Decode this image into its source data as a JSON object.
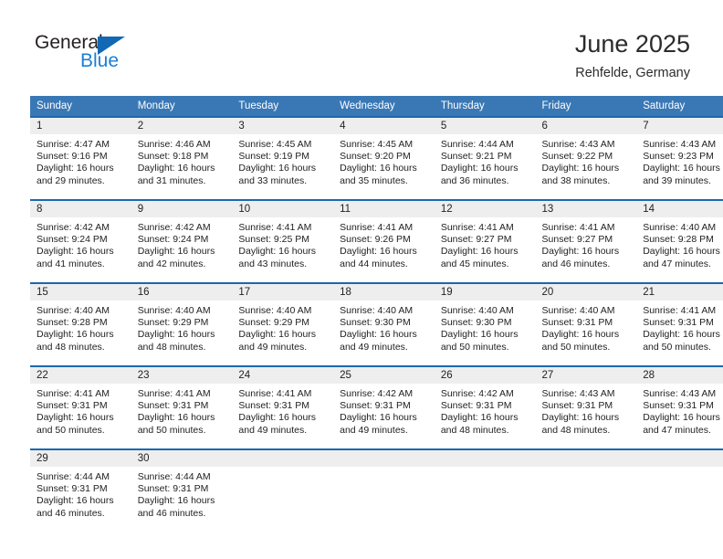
{
  "logo": {
    "general_text": "General",
    "blue_text": "Blue",
    "triangle_color": "#1268b3",
    "blue_color": "#1b7fd4"
  },
  "header": {
    "title": "June 2025",
    "subtitle": "Rehfelde, Germany"
  },
  "theme": {
    "header_bg": "#3a78b5",
    "row_divider": "#1a68b0",
    "daynum_bg": "#eeeeee"
  },
  "calendar": {
    "weekday_headers": [
      "Sunday",
      "Monday",
      "Tuesday",
      "Wednesday",
      "Thursday",
      "Friday",
      "Saturday"
    ],
    "weeks": [
      [
        {
          "day": "1",
          "sunrise": "Sunrise: 4:47 AM",
          "sunset": "Sunset: 9:16 PM",
          "daylight_1": "Daylight: 16 hours",
          "daylight_2": "and 29 minutes."
        },
        {
          "day": "2",
          "sunrise": "Sunrise: 4:46 AM",
          "sunset": "Sunset: 9:18 PM",
          "daylight_1": "Daylight: 16 hours",
          "daylight_2": "and 31 minutes."
        },
        {
          "day": "3",
          "sunrise": "Sunrise: 4:45 AM",
          "sunset": "Sunset: 9:19 PM",
          "daylight_1": "Daylight: 16 hours",
          "daylight_2": "and 33 minutes."
        },
        {
          "day": "4",
          "sunrise": "Sunrise: 4:45 AM",
          "sunset": "Sunset: 9:20 PM",
          "daylight_1": "Daylight: 16 hours",
          "daylight_2": "and 35 minutes."
        },
        {
          "day": "5",
          "sunrise": "Sunrise: 4:44 AM",
          "sunset": "Sunset: 9:21 PM",
          "daylight_1": "Daylight: 16 hours",
          "daylight_2": "and 36 minutes."
        },
        {
          "day": "6",
          "sunrise": "Sunrise: 4:43 AM",
          "sunset": "Sunset: 9:22 PM",
          "daylight_1": "Daylight: 16 hours",
          "daylight_2": "and 38 minutes."
        },
        {
          "day": "7",
          "sunrise": "Sunrise: 4:43 AM",
          "sunset": "Sunset: 9:23 PM",
          "daylight_1": "Daylight: 16 hours",
          "daylight_2": "and 39 minutes."
        }
      ],
      [
        {
          "day": "8",
          "sunrise": "Sunrise: 4:42 AM",
          "sunset": "Sunset: 9:24 PM",
          "daylight_1": "Daylight: 16 hours",
          "daylight_2": "and 41 minutes."
        },
        {
          "day": "9",
          "sunrise": "Sunrise: 4:42 AM",
          "sunset": "Sunset: 9:24 PM",
          "daylight_1": "Daylight: 16 hours",
          "daylight_2": "and 42 minutes."
        },
        {
          "day": "10",
          "sunrise": "Sunrise: 4:41 AM",
          "sunset": "Sunset: 9:25 PM",
          "daylight_1": "Daylight: 16 hours",
          "daylight_2": "and 43 minutes."
        },
        {
          "day": "11",
          "sunrise": "Sunrise: 4:41 AM",
          "sunset": "Sunset: 9:26 PM",
          "daylight_1": "Daylight: 16 hours",
          "daylight_2": "and 44 minutes."
        },
        {
          "day": "12",
          "sunrise": "Sunrise: 4:41 AM",
          "sunset": "Sunset: 9:27 PM",
          "daylight_1": "Daylight: 16 hours",
          "daylight_2": "and 45 minutes."
        },
        {
          "day": "13",
          "sunrise": "Sunrise: 4:41 AM",
          "sunset": "Sunset: 9:27 PM",
          "daylight_1": "Daylight: 16 hours",
          "daylight_2": "and 46 minutes."
        },
        {
          "day": "14",
          "sunrise": "Sunrise: 4:40 AM",
          "sunset": "Sunset: 9:28 PM",
          "daylight_1": "Daylight: 16 hours",
          "daylight_2": "and 47 minutes."
        }
      ],
      [
        {
          "day": "15",
          "sunrise": "Sunrise: 4:40 AM",
          "sunset": "Sunset: 9:28 PM",
          "daylight_1": "Daylight: 16 hours",
          "daylight_2": "and 48 minutes."
        },
        {
          "day": "16",
          "sunrise": "Sunrise: 4:40 AM",
          "sunset": "Sunset: 9:29 PM",
          "daylight_1": "Daylight: 16 hours",
          "daylight_2": "and 48 minutes."
        },
        {
          "day": "17",
          "sunrise": "Sunrise: 4:40 AM",
          "sunset": "Sunset: 9:29 PM",
          "daylight_1": "Daylight: 16 hours",
          "daylight_2": "and 49 minutes."
        },
        {
          "day": "18",
          "sunrise": "Sunrise: 4:40 AM",
          "sunset": "Sunset: 9:30 PM",
          "daylight_1": "Daylight: 16 hours",
          "daylight_2": "and 49 minutes."
        },
        {
          "day": "19",
          "sunrise": "Sunrise: 4:40 AM",
          "sunset": "Sunset: 9:30 PM",
          "daylight_1": "Daylight: 16 hours",
          "daylight_2": "and 50 minutes."
        },
        {
          "day": "20",
          "sunrise": "Sunrise: 4:40 AM",
          "sunset": "Sunset: 9:31 PM",
          "daylight_1": "Daylight: 16 hours",
          "daylight_2": "and 50 minutes."
        },
        {
          "day": "21",
          "sunrise": "Sunrise: 4:41 AM",
          "sunset": "Sunset: 9:31 PM",
          "daylight_1": "Daylight: 16 hours",
          "daylight_2": "and 50 minutes."
        }
      ],
      [
        {
          "day": "22",
          "sunrise": "Sunrise: 4:41 AM",
          "sunset": "Sunset: 9:31 PM",
          "daylight_1": "Daylight: 16 hours",
          "daylight_2": "and 50 minutes."
        },
        {
          "day": "23",
          "sunrise": "Sunrise: 4:41 AM",
          "sunset": "Sunset: 9:31 PM",
          "daylight_1": "Daylight: 16 hours",
          "daylight_2": "and 50 minutes."
        },
        {
          "day": "24",
          "sunrise": "Sunrise: 4:41 AM",
          "sunset": "Sunset: 9:31 PM",
          "daylight_1": "Daylight: 16 hours",
          "daylight_2": "and 49 minutes."
        },
        {
          "day": "25",
          "sunrise": "Sunrise: 4:42 AM",
          "sunset": "Sunset: 9:31 PM",
          "daylight_1": "Daylight: 16 hours",
          "daylight_2": "and 49 minutes."
        },
        {
          "day": "26",
          "sunrise": "Sunrise: 4:42 AM",
          "sunset": "Sunset: 9:31 PM",
          "daylight_1": "Daylight: 16 hours",
          "daylight_2": "and 48 minutes."
        },
        {
          "day": "27",
          "sunrise": "Sunrise: 4:43 AM",
          "sunset": "Sunset: 9:31 PM",
          "daylight_1": "Daylight: 16 hours",
          "daylight_2": "and 48 minutes."
        },
        {
          "day": "28",
          "sunrise": "Sunrise: 4:43 AM",
          "sunset": "Sunset: 9:31 PM",
          "daylight_1": "Daylight: 16 hours",
          "daylight_2": "and 47 minutes."
        }
      ],
      [
        {
          "day": "29",
          "sunrise": "Sunrise: 4:44 AM",
          "sunset": "Sunset: 9:31 PM",
          "daylight_1": "Daylight: 16 hours",
          "daylight_2": "and 46 minutes."
        },
        {
          "day": "30",
          "sunrise": "Sunrise: 4:44 AM",
          "sunset": "Sunset: 9:31 PM",
          "daylight_1": "Daylight: 16 hours",
          "daylight_2": "and 46 minutes."
        },
        {
          "day": "",
          "sunrise": "",
          "sunset": "",
          "daylight_1": "",
          "daylight_2": ""
        },
        {
          "day": "",
          "sunrise": "",
          "sunset": "",
          "daylight_1": "",
          "daylight_2": ""
        },
        {
          "day": "",
          "sunrise": "",
          "sunset": "",
          "daylight_1": "",
          "daylight_2": ""
        },
        {
          "day": "",
          "sunrise": "",
          "sunset": "",
          "daylight_1": "",
          "daylight_2": ""
        },
        {
          "day": "",
          "sunrise": "",
          "sunset": "",
          "daylight_1": "",
          "daylight_2": ""
        }
      ]
    ]
  }
}
